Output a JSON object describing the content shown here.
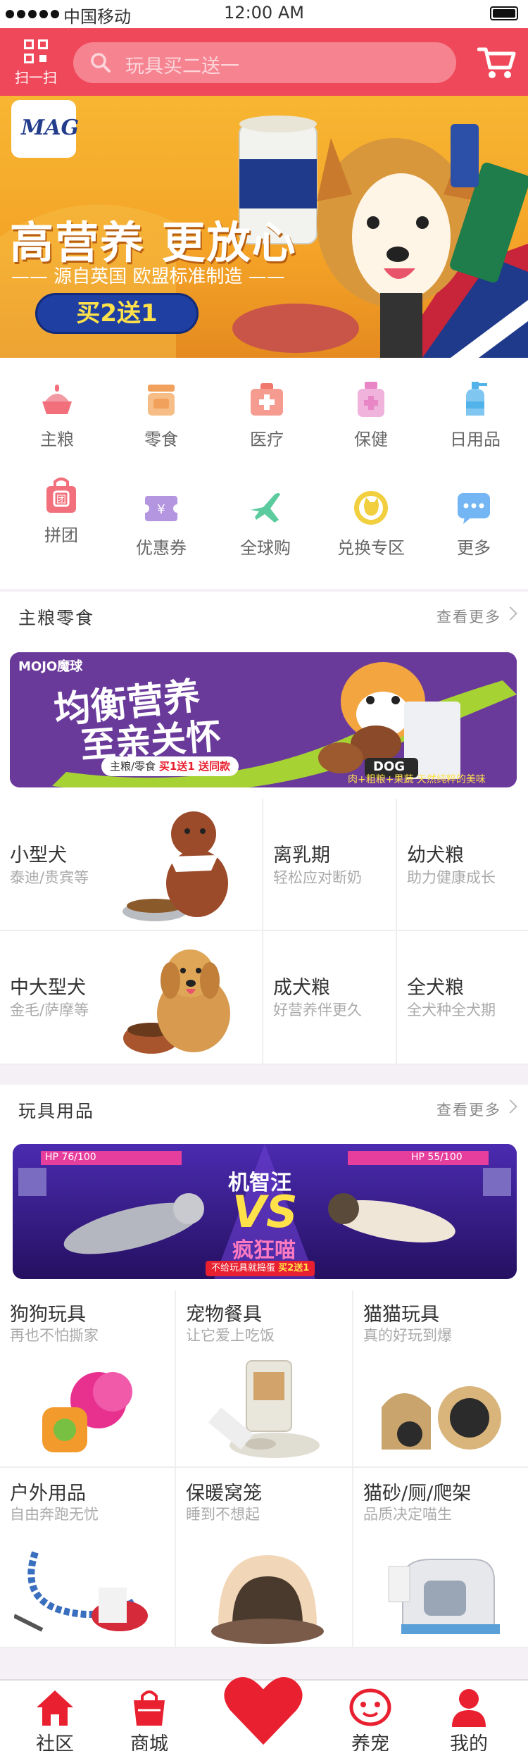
{
  "status_bar": {
    "carrier": "中国移动",
    "time": "12:00 AM"
  },
  "header": {
    "scan_label": "扫一扫",
    "search_placeholder": "玩具买二送一"
  },
  "banner": {
    "logo": "MAG",
    "headline": "高营养 更放心",
    "subline": "—— 源自英国  欧盟标准制造 ——",
    "button": "买2送1"
  },
  "categories": [
    {
      "label": "主粮",
      "icon": "food-bowl-icon",
      "color": "#f2707c"
    },
    {
      "label": "零食",
      "icon": "snack-jar-icon",
      "color": "#f2a15c"
    },
    {
      "label": "医疗",
      "icon": "medical-kit-icon",
      "color": "#f0786c"
    },
    {
      "label": "保健",
      "icon": "health-bottle-icon",
      "color": "#e886c6"
    },
    {
      "label": "日用品",
      "icon": "shampoo-bottle-icon",
      "color": "#52b3ea"
    },
    {
      "label": "拼团",
      "icon": "group-buy-bag-icon",
      "color": "#f2707c"
    },
    {
      "label": "优惠券",
      "icon": "coupon-icon",
      "color": "#b495e0"
    },
    {
      "label": "全球购",
      "icon": "airplane-icon",
      "color": "#5ccb9d"
    },
    {
      "label": "兑换专区",
      "icon": "exchange-coin-icon",
      "color": "#f1cf3e"
    },
    {
      "label": "更多",
      "icon": "more-chat-icon",
      "color": "#73b6f3"
    }
  ],
  "section_food": {
    "title": "主粮零食",
    "more": "查看更多"
  },
  "promo_food": {
    "brand": "MOJO魔球",
    "line1": "均衡营养",
    "line2": "至亲关怀",
    "offer_prefix": "主粮/零食",
    "offer": "买1送1 送同款",
    "bag_label": "DOG",
    "tagline": "肉+粗粮+果蔬 天然纯粹的美味"
  },
  "food_items": [
    {
      "title": "小型犬",
      "sub": "泰迪/贵宾等"
    },
    {
      "title": "离乳期",
      "sub": "轻松应对断奶"
    },
    {
      "title": "幼犬粮",
      "sub": "助力健康成长"
    },
    {
      "title": "中大型犬",
      "sub": "金毛/萨摩等"
    },
    {
      "title": "成犬粮",
      "sub": "好营养伴更久"
    },
    {
      "title": "全犬粮",
      "sub": "全犬种全犬期"
    }
  ],
  "section_toys": {
    "title": "玩具用品",
    "more": "查看更多"
  },
  "promo_toys": {
    "hp_left": "HP 76/100",
    "hp_right": "HP 55/100",
    "top": "机智汪",
    "vs": "VS",
    "bottom": "疯狂喵",
    "offer_prefix": "不给玩具就捣蛋",
    "offer": "买2送1"
  },
  "toy_items": [
    {
      "title": "狗狗玩具",
      "sub": "再也不怕撕家"
    },
    {
      "title": "宠物餐具",
      "sub": "让它爱上吃饭"
    },
    {
      "title": "猫猫玩具",
      "sub": "真的好玩到爆"
    },
    {
      "title": "户外用品",
      "sub": "自由奔跑无忧"
    },
    {
      "title": "保暖窝笼",
      "sub": "睡到不想起"
    },
    {
      "title": "猫砂/厕/爬架",
      "sub": "品质决定喵生"
    }
  ],
  "tabbar": [
    {
      "label": "社区",
      "icon": "house-icon"
    },
    {
      "label": "商城",
      "icon": "shopping-bag-icon"
    },
    {
      "label": "",
      "icon": "heart-icon"
    },
    {
      "label": "养宠",
      "icon": "pet-face-icon"
    },
    {
      "label": "我的",
      "icon": "user-icon"
    }
  ],
  "colors": {
    "primary": "#f0485b",
    "tab_red": "#e8202f"
  }
}
